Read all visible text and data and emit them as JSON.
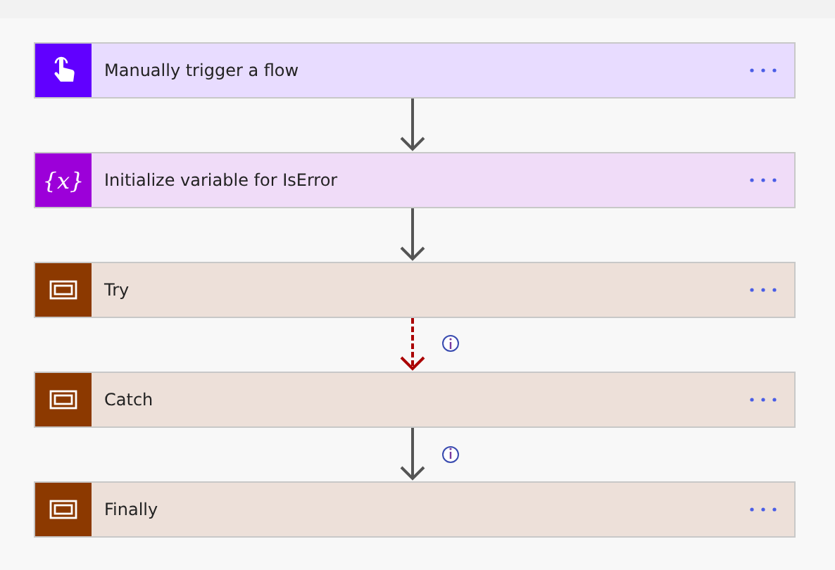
{
  "steps": [
    {
      "kind": "trigger",
      "title": "Manually trigger a flow",
      "color": "#6100ff"
    },
    {
      "kind": "variable",
      "title": "Initialize variable for IsError",
      "icon_text": "{x}",
      "color": "#9c00d9"
    },
    {
      "kind": "scope",
      "title": "Try",
      "color": "#8c3900"
    },
    {
      "kind": "scope",
      "title": "Catch",
      "color": "#8c3900"
    },
    {
      "kind": "scope",
      "title": "Finally",
      "color": "#8c3900"
    }
  ],
  "connectors": [
    {
      "kind": "solid",
      "info": false
    },
    {
      "kind": "solid",
      "info": false
    },
    {
      "kind": "dashed",
      "info": true
    },
    {
      "kind": "solid",
      "info": true
    }
  ]
}
